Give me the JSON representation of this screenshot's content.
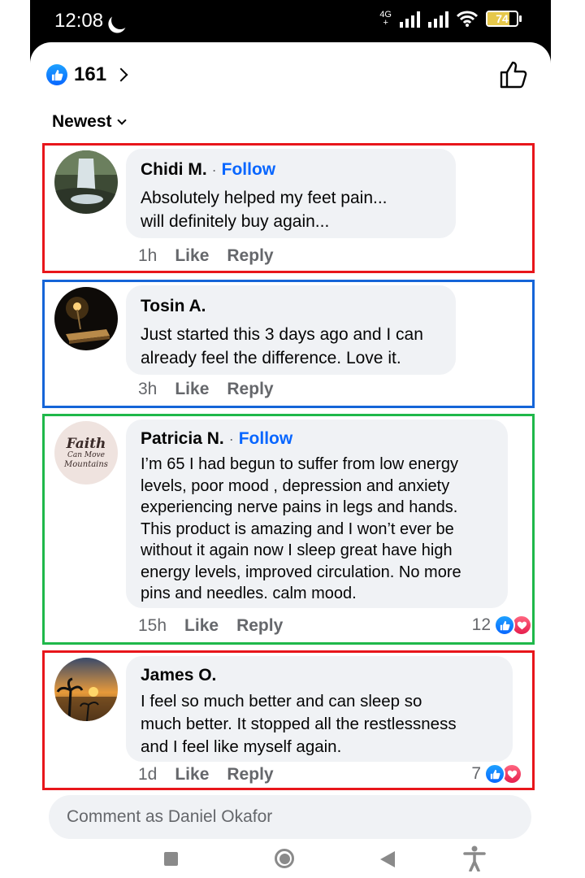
{
  "status_bar": {
    "time": "12:08",
    "network": "4G",
    "battery": "74",
    "battery_level": 0.74
  },
  "reactions": {
    "count": "161",
    "icon": "like-icon"
  },
  "sort": {
    "label": "Newest"
  },
  "comments": [
    {
      "author": "Chidi M.",
      "follow": "Follow",
      "text_lines": [
        "Absolutely helped my feet pain...",
        "will definitely buy again..."
      ],
      "time": "1h",
      "like": "Like",
      "reply": "Reply",
      "highlight": "#e8161b"
    },
    {
      "author": "Tosin A.",
      "text_lines": [
        "Just started this 3 days ago and I can",
        "already feel the difference. Love it."
      ],
      "time": "3h",
      "like": "Like",
      "reply": "Reply",
      "highlight": "#1565d8"
    },
    {
      "author": "Patricia N.",
      "follow": "Follow",
      "avatar_text": [
        "Faith",
        "Can Move",
        "Mountains"
      ],
      "text_lines": [
        "I’m 65 I had begun to suffer from low energy",
        "levels, poor mood , depression and anxiety",
        "experiencing nerve pains in legs and hands.",
        "This product is amazing and I won’t ever be",
        "without it again now I sleep great have high",
        "energy levels, improved circulation. No more",
        "pins and needles. calm mood."
      ],
      "time": "15h",
      "like": "Like",
      "reply": "Reply",
      "reaction_count": "12",
      "highlight": "#1fb84a"
    },
    {
      "author": "James O.",
      "text_lines": [
        "I feel so much better and can sleep so",
        "much better. It stopped all the restlessness",
        "and I feel like myself again."
      ],
      "time": "1d",
      "like": "Like",
      "reply": "Reply",
      "reaction_count": "7",
      "highlight": "#e8161b"
    }
  ],
  "comment_input": {
    "placeholder": "Comment as Daniel Okafor"
  },
  "colors": {
    "accent": "#0866ff",
    "bubble": "#f0f2f5",
    "muted_text": "#65676b"
  }
}
